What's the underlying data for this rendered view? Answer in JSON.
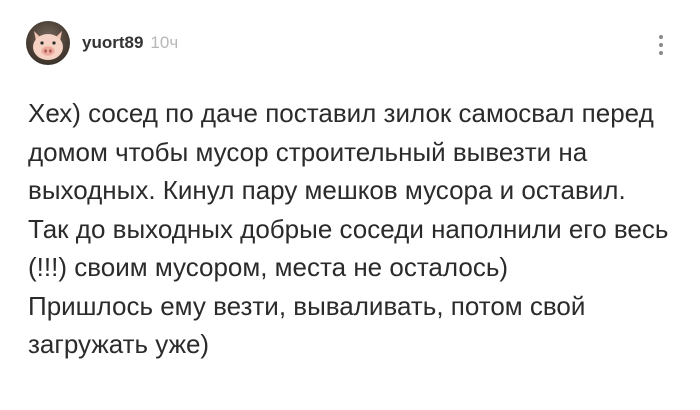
{
  "comment": {
    "author": {
      "username": "yuort89",
      "avatar_icon": "pig-avatar-icon"
    },
    "time": "10ч",
    "more_icon": "more-vertical-icon",
    "body": {
      "paragraph_1": "Хех) сосед по даче поставил зилок самосвал перед домом чтобы мусор строительный вывезти на выходных. Кинул пару мешков мусора и оставил.",
      "paragraph_2": "Так до выходных добрые соседи наполнили его весь (!!!) своим мусором, места не осталось)",
      "paragraph_3": "Пришлось ему везти, вываливать, потом свой загружать уже)"
    }
  },
  "colors": {
    "text": "#2b2b2b",
    "username": "#333333",
    "time": "#b7b7b7",
    "icon": "#8a8a8a",
    "background": "#ffffff"
  }
}
